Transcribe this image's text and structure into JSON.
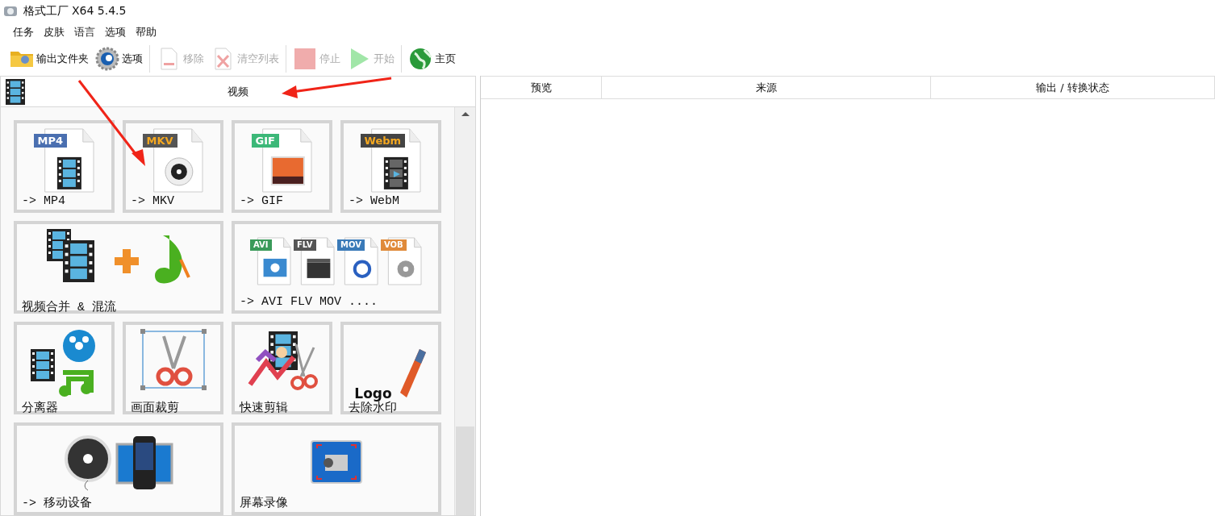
{
  "window": {
    "title": "格式工厂 X64 5.4.5"
  },
  "menu": [
    "任务",
    "皮肤",
    "语言",
    "选项",
    "帮助"
  ],
  "toolbar": [
    {
      "label": "输出文件夹",
      "kind": "folder",
      "disabled": false,
      "separator_before": false
    },
    {
      "label": "选项",
      "kind": "gear",
      "disabled": false,
      "separator_before": false
    },
    {
      "label": "移除",
      "kind": "remove",
      "disabled": true,
      "separator_before": true
    },
    {
      "label": "清空列表",
      "kind": "clear",
      "disabled": true,
      "separator_before": false
    },
    {
      "label": "停止",
      "kind": "stop",
      "disabled": true,
      "separator_before": true
    },
    {
      "label": "开始",
      "kind": "start",
      "disabled": true,
      "separator_before": false
    },
    {
      "label": "主页",
      "kind": "home",
      "disabled": false,
      "separator_before": true
    }
  ],
  "panel": {
    "title": "视频"
  },
  "tiles": [
    {
      "label": "-> MP4",
      "kind": "mp4",
      "wide": false,
      "badges": [
        {
          "text": "MP4",
          "color": "#4a6fb0"
        }
      ]
    },
    {
      "label": "-> MKV",
      "kind": "mkv",
      "wide": false,
      "badges": [
        {
          "text": "MKV",
          "color": "#555555"
        }
      ]
    },
    {
      "label": "-> GIF",
      "kind": "gif",
      "wide": false,
      "badges": [
        {
          "text": "GIF",
          "color": "#3cb878"
        }
      ]
    },
    {
      "label": "-> WebM",
      "kind": "webm",
      "wide": false,
      "badges": [
        {
          "text": "Webm",
          "color": "#444444"
        }
      ]
    },
    {
      "label": "视频合并 & 混流",
      "kind": "merge",
      "wide": true
    },
    {
      "label": "-> AVI FLV MOV ....",
      "kind": "multi",
      "wide": true,
      "badges": [
        {
          "text": "AVI",
          "color": "#3a9a5a"
        },
        {
          "text": "FLV",
          "color": "#555555"
        },
        {
          "text": "MOV",
          "color": "#3a7ab8"
        },
        {
          "text": "VOB",
          "color": "#e08a3a"
        }
      ]
    },
    {
      "label": "分离器",
      "kind": "split",
      "wide": false
    },
    {
      "label": "画面裁剪",
      "kind": "crop",
      "wide": false
    },
    {
      "label": "快速剪辑",
      "kind": "quickcut",
      "wide": false
    },
    {
      "label": "去除水印",
      "kind": "watermark",
      "wide": false,
      "logo_text": "Logo"
    },
    {
      "label": "-> 移动设备",
      "kind": "mobile",
      "wide": true
    },
    {
      "label": "屏幕录像",
      "kind": "record",
      "wide": true
    }
  ],
  "table": {
    "columns": [
      "预览",
      "来源",
      "输出 / 转换状态"
    ]
  },
  "annotations": [
    {
      "kind": "arrow"
    },
    {
      "kind": "arrow"
    }
  ]
}
